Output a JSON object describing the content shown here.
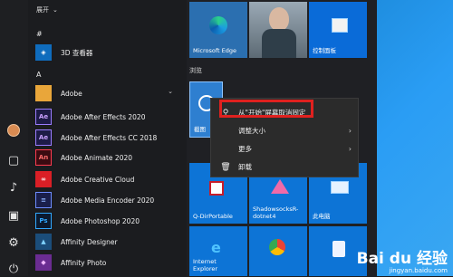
{
  "list": {
    "expand_label": "展开",
    "expand_icon": "chevron-down",
    "headers": [
      "#",
      "A"
    ],
    "items": [
      {
        "label": "3D 查看器",
        "icon_text": "",
        "icon_color": "#0f6cbd"
      },
      {
        "label": "Adobe",
        "icon_text": "",
        "icon_color": "#e9a63a",
        "chevron": "⌄"
      },
      {
        "label": "Adobe After Effects 2020",
        "icon_text": "Ae",
        "icon_color": "#1d1b47"
      },
      {
        "label": "Adobe After Effects CC 2018",
        "icon_text": "Ae",
        "icon_color": "#1d1b47"
      },
      {
        "label": "Adobe Animate 2020",
        "icon_text": "An",
        "icon_color": "#3b0b11"
      },
      {
        "label": "Adobe Creative Cloud",
        "icon_text": "",
        "icon_color": "#da1f26"
      },
      {
        "label": "Adobe Media Encoder 2020",
        "icon_text": "",
        "icon_color": "#1a1f4b"
      },
      {
        "label": "Adobe Photoshop 2020",
        "icon_text": "Ps",
        "icon_color": "#0b1a2f"
      },
      {
        "label": "Affinity Designer",
        "icon_text": "",
        "icon_color": "#1b4d7a"
      },
      {
        "label": "Affinity Photo",
        "icon_text": "",
        "icon_color": "#6a2c91"
      }
    ]
  },
  "tiles": {
    "edge_label": "Microsoft Edge",
    "control_panel_label": "控制面板",
    "group_title": "浏览",
    "pinned_partial_label": "截图",
    "qdir_label": "Q-DirPortable",
    "shadowsocks_label": "ShadowsocksR-\ndotnet4",
    "this_pc_label": "此电脑",
    "ie_label": "Internet\nExplorer"
  },
  "context_menu": {
    "items": [
      {
        "icon": "unpin",
        "icon_glyph": "⚲",
        "label": "从\"开始\"屏幕取消固定",
        "arrow": ""
      },
      {
        "icon": "",
        "icon_glyph": "",
        "label": "调整大小",
        "arrow": "›"
      },
      {
        "icon": "",
        "icon_glyph": "",
        "label": "更多",
        "arrow": "›"
      },
      {
        "icon": "trash",
        "icon_glyph": "🗑",
        "label": "卸载",
        "arrow": ""
      }
    ]
  },
  "watermark": {
    "brand": "Bai du 经验",
    "url": "jingyan.baidu.com"
  }
}
